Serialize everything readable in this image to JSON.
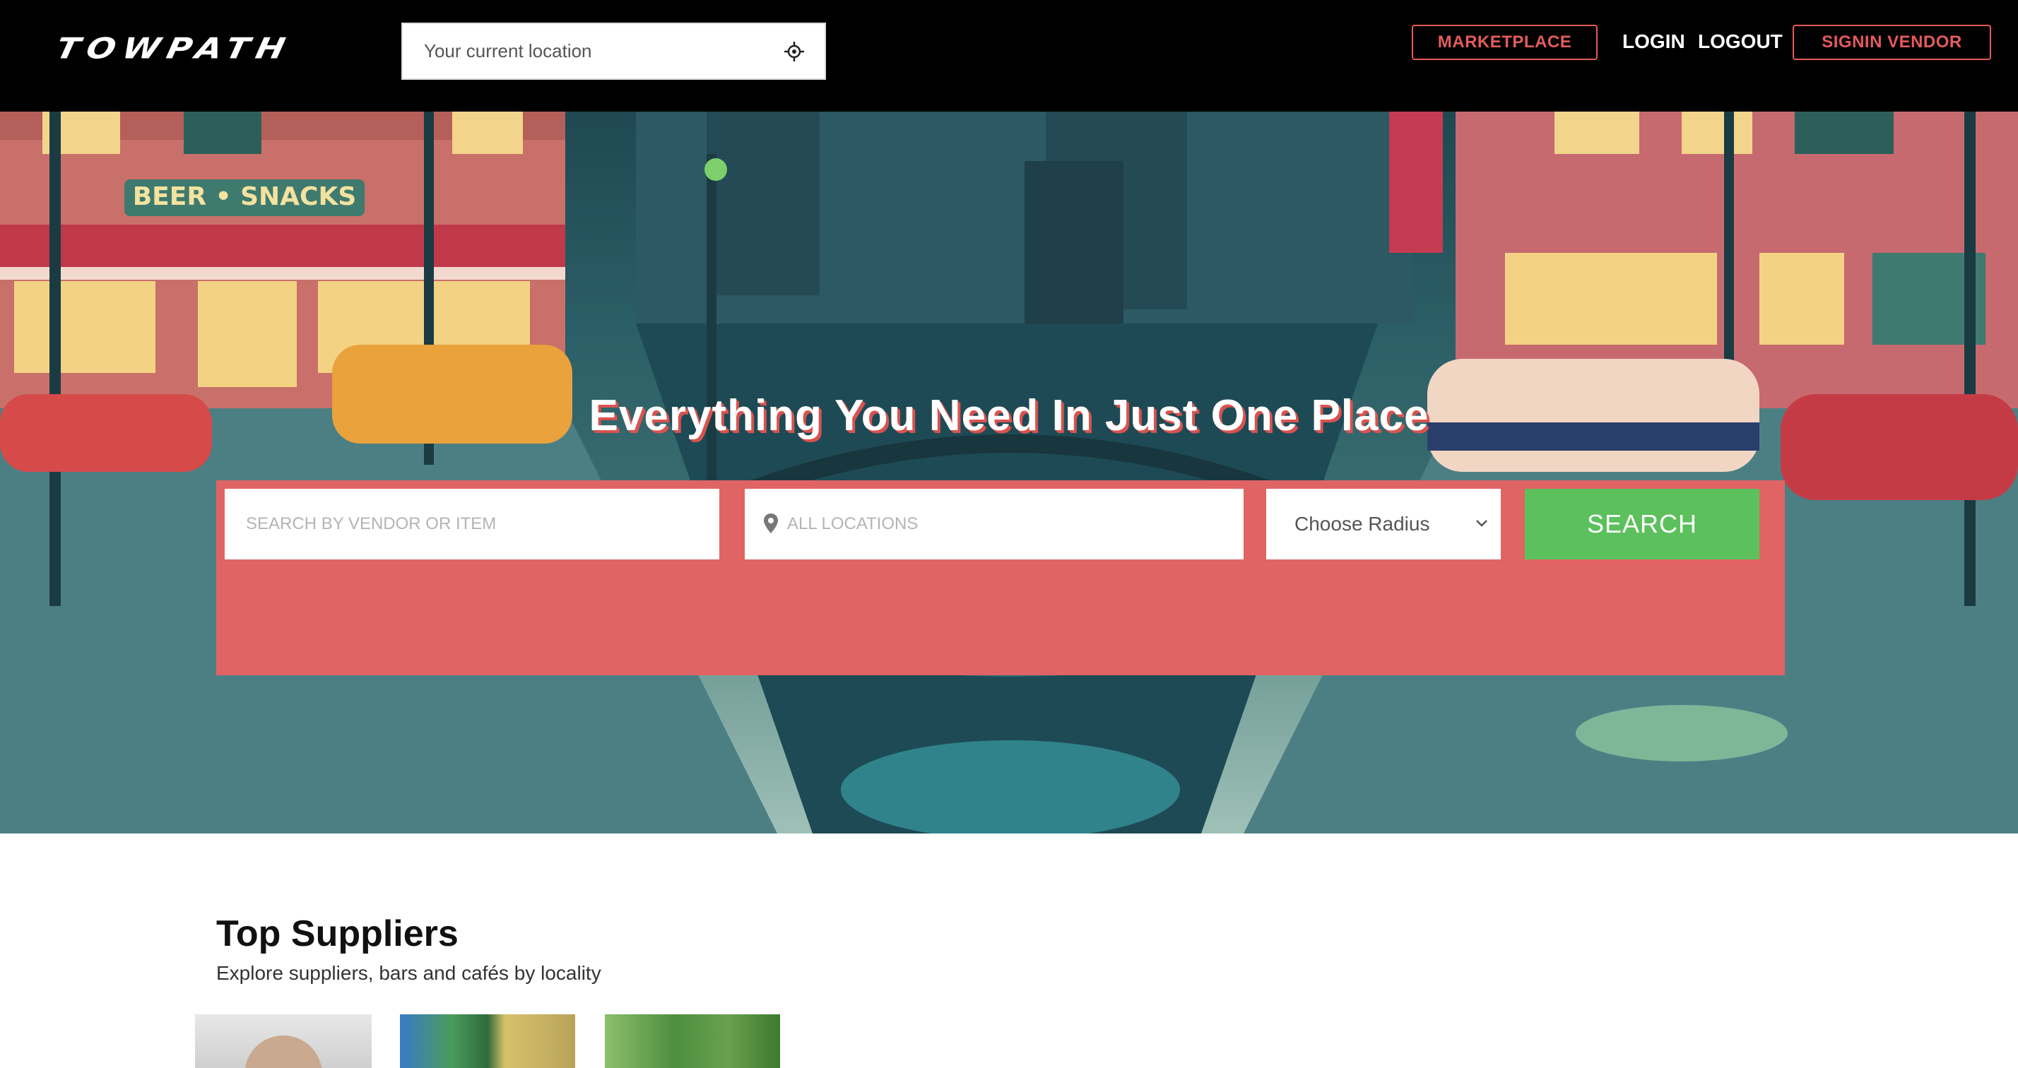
{
  "brand": {
    "logo_text": "TOWPATH"
  },
  "navbar": {
    "location_placeholder": "Your current location",
    "marketplace_label": "MARKETPLACE",
    "login_label": "LOGIN",
    "logout_label": "LOGOUT",
    "signin_vendor_label": "SIGNIN VENDOR",
    "locate_icon": "crosshair-icon"
  },
  "hero": {
    "headline": "Everything You Need In Just One Place",
    "background_sign_beer": "BEER • SNACKS",
    "search": {
      "vendor_placeholder": "SEARCH BY VENDOR OR ITEM",
      "locations_placeholder": "ALL LOCATIONS",
      "radius_selected": "Choose Radius",
      "search_button_label": "SEARCH",
      "pin_icon": "map-pin-icon",
      "chevron_icon": "chevron-down-icon"
    }
  },
  "top_suppliers": {
    "title": "Top Suppliers",
    "subtitle": "Explore suppliers, bars and cafés by locality"
  },
  "colors": {
    "accent_red": "#e06464",
    "search_green": "#5cc05c",
    "navbar_bg": "#000000"
  }
}
